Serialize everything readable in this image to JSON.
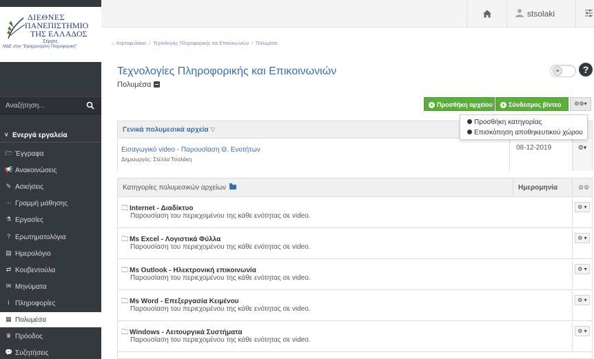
{
  "logo": {
    "line1": "ΔΙΕΘΝΕΣ",
    "line2": "ΠΑΝΕΠΙΣΤΗΜΙΟ",
    "line3": "ΤΗΣ ΕΛΛΑΔΟΣ",
    "line4": "Σέρρες",
    "line5": "ΜΔΕ στην \"Εφαρμοσμένη Πληροφορική\""
  },
  "sidebar": {
    "search_placeholder": "Αναζήτηση...",
    "section_title": "Ενεργά εργαλεία",
    "items": [
      {
        "label": "Έγγραφα",
        "icon": "folder-open-icon",
        "glyph": "🗁"
      },
      {
        "label": "Ανακοινώσεις",
        "icon": "bullhorn-icon",
        "glyph": "📢"
      },
      {
        "label": "Ασκήσεις",
        "icon": "edit-icon",
        "glyph": "✎"
      },
      {
        "label": "Γραμμή μάθησης",
        "icon": "ellipsis-icon",
        "glyph": "⋯"
      },
      {
        "label": "Εργασίες",
        "icon": "flask-icon",
        "glyph": "⚗"
      },
      {
        "label": "Ερωτηματολόγια",
        "icon": "question-circle-icon",
        "glyph": "?"
      },
      {
        "label": "Ημερολόγιο",
        "icon": "calendar-icon",
        "glyph": "▤"
      },
      {
        "label": "Κουβεντούλα",
        "icon": "exchange-icon",
        "glyph": "⇄"
      },
      {
        "label": "Μηνύματα",
        "icon": "envelope-icon",
        "glyph": "✉"
      },
      {
        "label": "Πληροφορίες",
        "icon": "info-circle-icon",
        "glyph": "i"
      },
      {
        "label": "Πολυμέσα",
        "icon": "film-icon",
        "glyph": "▦"
      },
      {
        "label": "Πρόοδος",
        "icon": "trophy-icon",
        "glyph": "♛"
      },
      {
        "label": "Συζητήσεις",
        "icon": "comments-icon",
        "glyph": "💬"
      }
    ],
    "active_index": 10
  },
  "topbar": {
    "username": "stsolaki"
  },
  "breadcrumb": {
    "home": "Χαρτοφυλάκιο",
    "course": "Τεχνολογίες Πληροφορικής και Επικοινωνιών",
    "current": "Πολυμέσα"
  },
  "page": {
    "title": "Τεχνολογίες Πληροφορικής και Επικοινωνιών",
    "subtitle": "Πολυμέσα"
  },
  "actions": {
    "add_file": "Προσθήκη αρχείου",
    "link_video": "Σύνδεσμος βίντεο"
  },
  "dropdown": {
    "items": [
      "Προσθήκη κατηγορίας",
      "Επισκόπηση αποθηκευτικού χώρου"
    ]
  },
  "general": {
    "header": "Γενικά πολυμεσικά αρχεία",
    "items": [
      {
        "title": "Εισαγωγικό video - Παρουσίαση Θ. Ενοτήτων",
        "creator": "Δημιουργός: Στέλλα Τσολάκη",
        "date": "08-12-2019"
      }
    ]
  },
  "categories": {
    "header": "Κατηγορίες πολυμεσικών αρχείων",
    "date_header": "Ημερομηνία",
    "items": [
      {
        "title": "Internet - Διαδίκτυο",
        "desc": "Παρουσίαση του περιεχομένου της κάθε ενότητας σε video."
      },
      {
        "title": "Ms Excel - Λογιστικά Φύλλα",
        "desc": "Παρουσίαση του περιεχομένου της κάθε ενότητας σε video."
      },
      {
        "title": "Ms Outlook - Ηλεκτρονική επικοινωνία",
        "desc": "Παρουσίαση του περιεχομένου της κάθε ενότητας σε video."
      },
      {
        "title": "Ms Word - Επεξεργασία Κειμένου",
        "desc": "Παρουσίαση του περιεχομένου της κάθε ενότητας σε video."
      },
      {
        "title": "Windows - Λειτουργικά Συστήματα",
        "desc": "Παρουσίαση του περιεχομένου της κάθε ενότητας σε video."
      }
    ]
  }
}
